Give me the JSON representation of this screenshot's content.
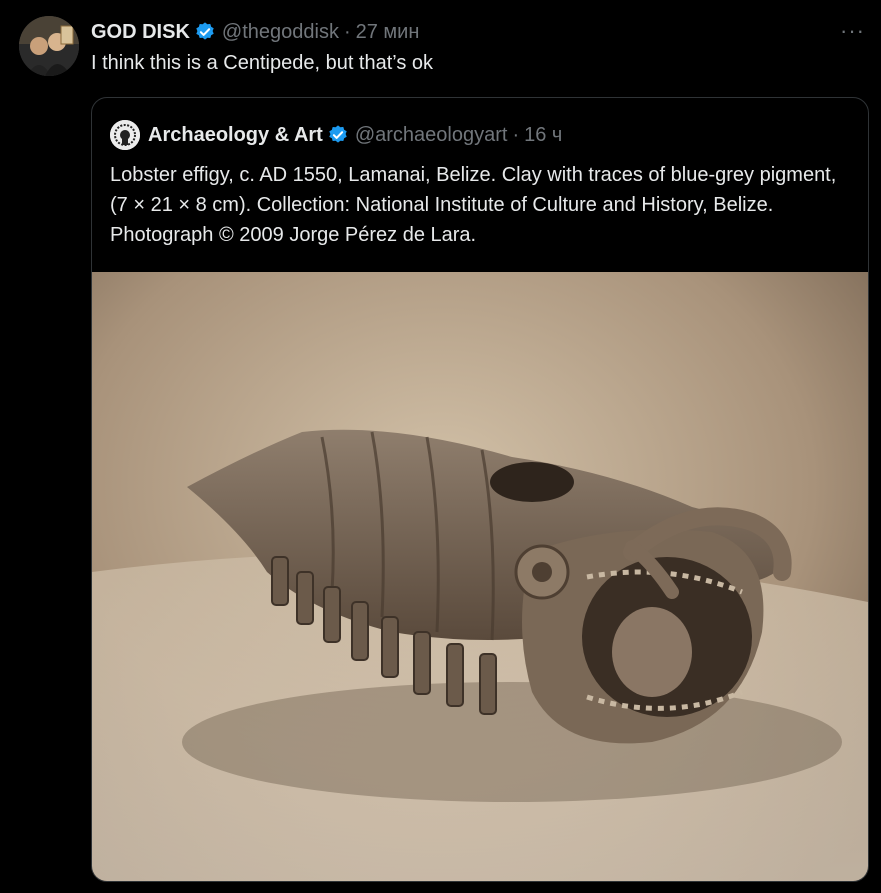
{
  "tweet": {
    "author_name": "GOD DISK",
    "author_handle": "@thegoddisk",
    "separator": "·",
    "time": "27 мин",
    "more_label": "···",
    "text": "I think this is a Centipede, but that’s ok"
  },
  "quoted": {
    "author_name": "Archaeology & Art",
    "author_handle": "@archaeologyart",
    "separator": "·",
    "time": "16 ч",
    "text": "Lobster effigy, c. AD 1550, Lamanai, Belize. Clay with traces of blue-grey pigment,  (7 × 21 × 8 cm). Collection: National Institute of Culture and History, Belize.  Photograph © 2009 Jorge Pérez de Lara."
  },
  "icons": {
    "verified": "verified-badge-icon",
    "more": "more-options-icon"
  },
  "colors": {
    "background": "#000000",
    "text_primary": "#e7e9ea",
    "text_secondary": "#71767b",
    "verified_blue": "#1d9bf0",
    "border": "#2f3336"
  }
}
